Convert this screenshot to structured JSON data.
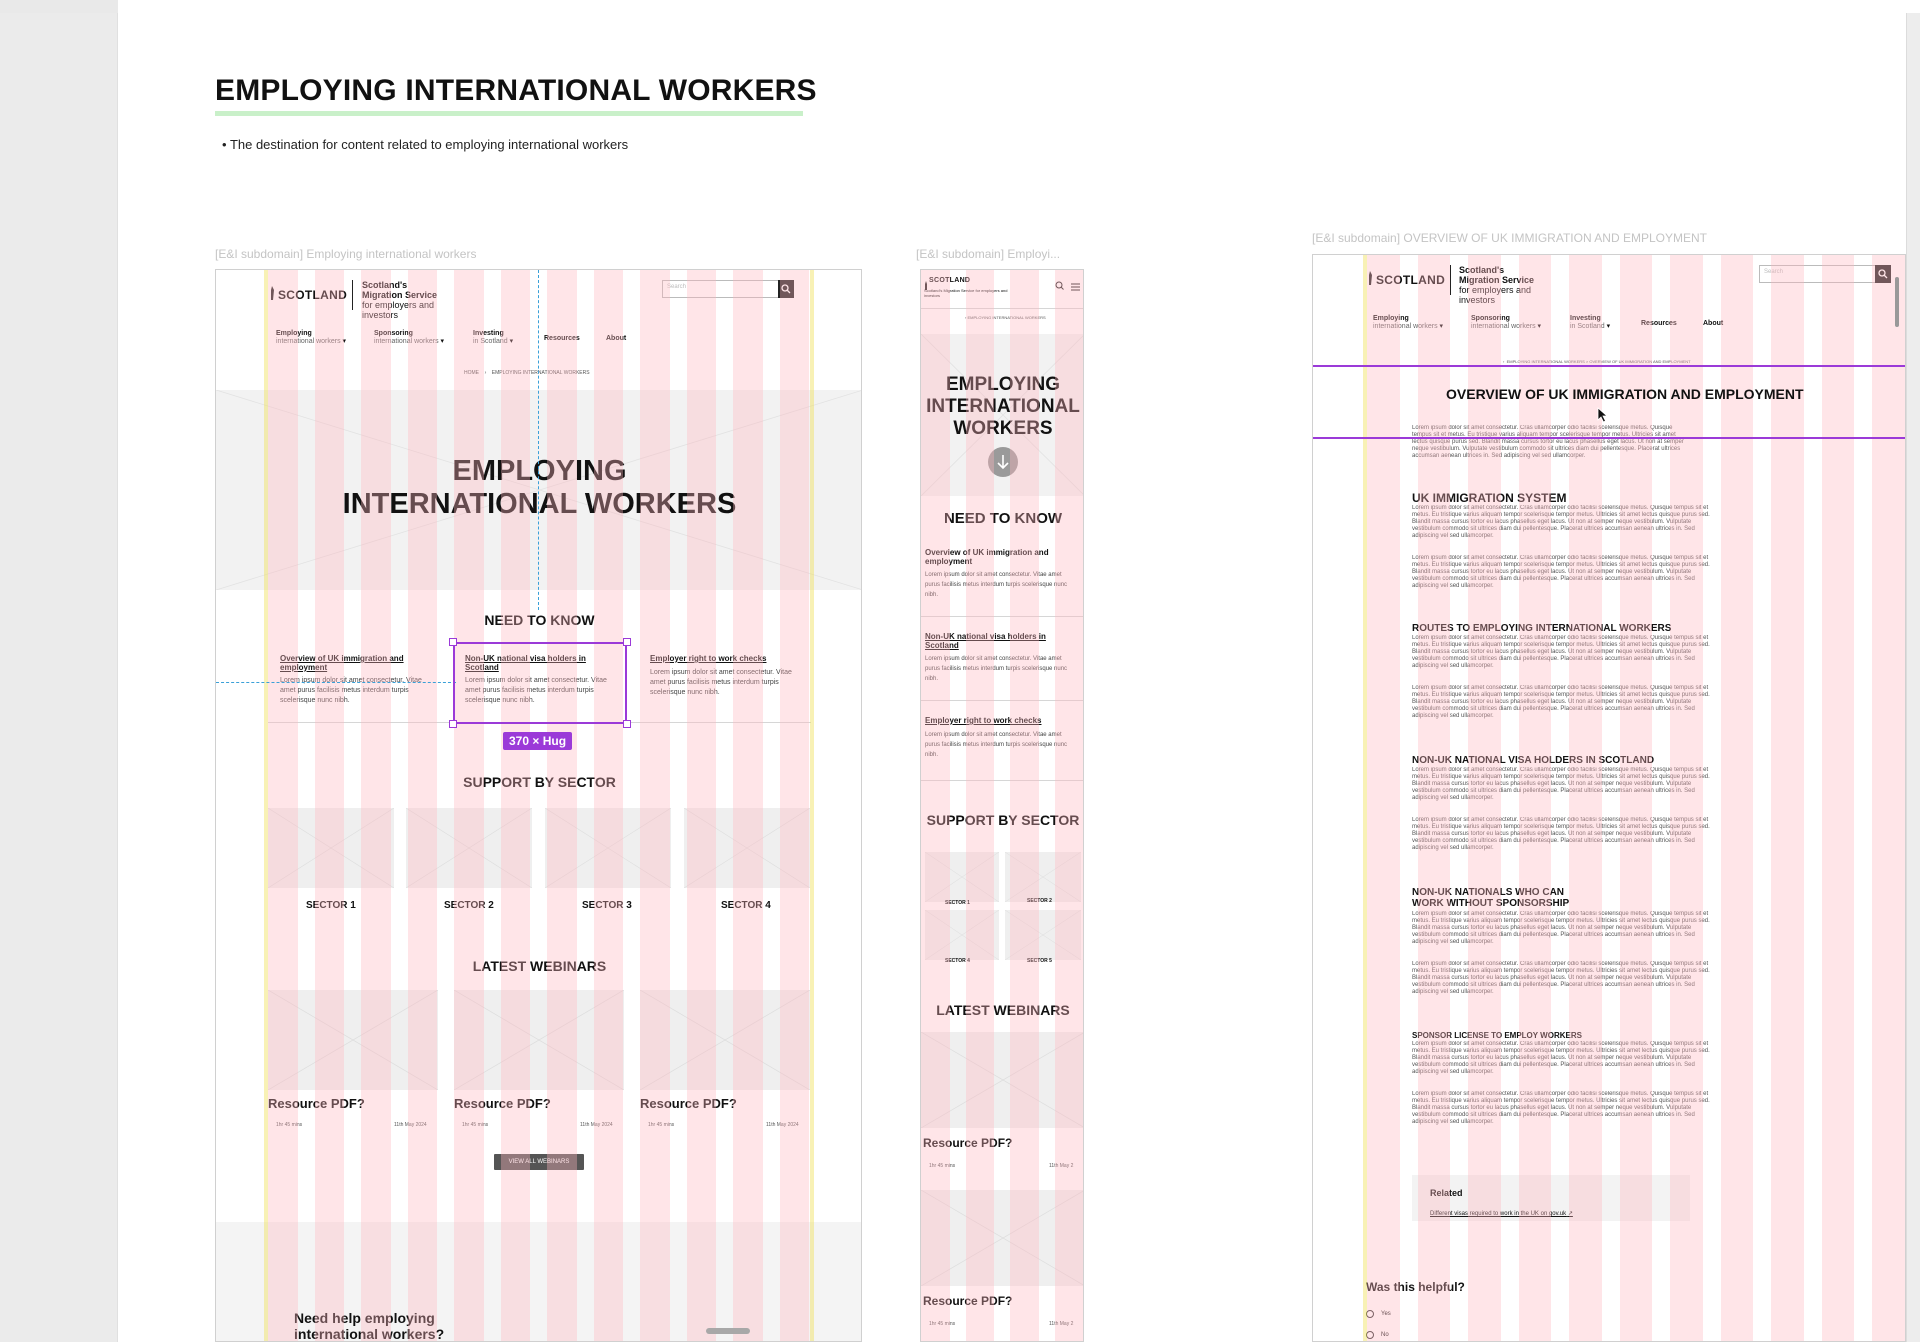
{
  "page": {
    "title": "EMPLOYING INTERNATIONAL WORKERS",
    "description": "The destination for content related to employing international workers"
  },
  "desktop": {
    "frame_label": "[E&I subdomain] Employing international workers",
    "logo": "SCOTLAND",
    "brand_line1": "Scotland's",
    "brand_line2": "Migration Service",
    "brand_line3": "for employers and",
    "brand_line4": "investors",
    "search_placeholder": "Search",
    "nav": [
      {
        "label": "Employing",
        "sub": "international workers"
      },
      {
        "label": "Sponsoring",
        "sub": "international workers"
      },
      {
        "label": "Investing",
        "sub": "in Scotland"
      },
      {
        "label": "Resources",
        "sub": ""
      },
      {
        "label": "About",
        "sub": ""
      }
    ],
    "breadcrumb_home": "HOME",
    "breadcrumb_current": "EMPLOYING INTERNATIONAL WORKERS",
    "hero_line1": "EMPLOYING",
    "hero_line2": "INTERNATIONAL WORKERS",
    "need_to_know": "NEED TO KNOW",
    "cards": [
      {
        "title": "Overview of UK immigration and employment",
        "body": "Lorem ipsum dolor sit amet consectetur. Vitae amet purus facilisis metus interdum turpis scelerisque nunc nibh."
      },
      {
        "title": "Non-UK national visa holders in Scotland",
        "body": "Lorem ipsum dolor sit amet consectetur. Vitae amet purus facilisis metus interdum turpis scelerisque nunc nibh."
      },
      {
        "title": "Employer right to work checks",
        "body": "Lorem ipsum dolor sit amet consectetur. Vitae amet purus facilisis metus interdum turpis scelerisque nunc nibh."
      }
    ],
    "hug_badge": "370 × Hug",
    "support_by_sector": "SUPPORT BY SECTOR",
    "sectors": [
      "SECTOR 1",
      "SECTOR 2",
      "SECTOR 3",
      "SECTOR 4"
    ],
    "latest_webinars": "LATEST WEBINARS",
    "resources": [
      {
        "title": "Resource PDF?",
        "duration": "1hr 45 mins",
        "date": "11th May 2024"
      },
      {
        "title": "Resource PDF?",
        "duration": "1hr 45 mins",
        "date": "11th May 2024"
      },
      {
        "title": "Resource PDF?",
        "duration": "1hr 45 mins",
        "date": "11th May 2024"
      }
    ],
    "view_all": "VIEW ALL WEBINARS",
    "need_help_line1": "Need help employing",
    "need_help_line2": "international workers?"
  },
  "mobile": {
    "frame_label": "[E&I subdomain] Employi...",
    "logo": "SCOTLAND",
    "brand": "Scotland's Migration Service for employers and investors",
    "breadcrumb": "EMPLOYING INTERNATIONAL WORKERS",
    "hero_line1": "EMPLOYING",
    "hero_line2": "INTERNATIONAL",
    "hero_line3": "WORKERS",
    "need_to_know": "NEED TO KNOW",
    "cards": [
      {
        "title": "Overview of UK immigration and employment",
        "body": "Lorem ipsum dolor sit amet consectetur. Vitae amet purus facilisis metus interdum turpis scelerisque nunc nibh."
      },
      {
        "title": "Non-UK national visa holders in Scotland",
        "body": "Lorem ipsum dolor sit amet consectetur. Vitae amet purus facilisis metus interdum turpis scelerisque nunc nibh."
      },
      {
        "title": "Employer right to work checks",
        "body": "Lorem ipsum dolor sit amet consectetur. Vitae amet purus facilisis metus interdum turpis scelerisque nunc nibh."
      }
    ],
    "support_by_sector": "SUPPORT BY SECTOR",
    "sectors": [
      "SECTOR 1",
      "SECTOR 2",
      "SECTOR 4",
      "SECTOR 5"
    ],
    "latest_webinars": "LATEST WEBINARS",
    "resource_title": "Resource PDF?",
    "resource_duration": "1hr 45 mins",
    "resource_date": "11th May 2",
    "resource2_title": "Resource PDF?",
    "resource2_duration": "1hr 45 mins",
    "resource2_date": "11th May 2"
  },
  "article": {
    "frame_label": "[E&I subdomain] OVERVIEW OF UK IMMIGRATION AND EMPLOYMENT",
    "logo": "SCOTLAND",
    "brand_line1": "Scotland's",
    "brand_line2": "Migration Service",
    "brand_line3": "for employers and",
    "brand_line4": "investors",
    "search_placeholder": "Search",
    "nav": [
      {
        "label": "Employing",
        "sub": "international workers"
      },
      {
        "label": "Sponsoring",
        "sub": "international workers"
      },
      {
        "label": "Investing",
        "sub": "in Scotland"
      },
      {
        "label": "Resources",
        "sub": ""
      },
      {
        "label": "About",
        "sub": ""
      }
    ],
    "breadcrumb": "EMPLOYING INTERNATIONAL WORKERS   >   OVERVIEW OF UK IMMIGRATION AND EMPLOYMENT",
    "title": "OVERVIEW OF UK IMMIGRATION AND EMPLOYMENT",
    "intro": "Lorem ipsum dolor sit amet consectetur. Cras ullamcorper odio facilisi scelerisque metus. Quisque tempus sit et metus. Eu tristique varius aliquam tempor scelerisque tempor metus. Ultricies sit amet lectus quisque purus sed. Blandit massa cursus tortor eu lacus phasellus eget lacus. Ut non at semper neque vestibulum. Vulputate vestibulum commodo sit ultrices diam dui pellentesque. Placerat ultrices accumsan aenean ultrices in. Sed adipiscing vel sed ullamcorper.",
    "sections": [
      "UK IMMIGRATION SYSTEM",
      "ROUTES TO EMPLOYING INTERNATIONAL WORKERS",
      "NON-UK NATIONAL VISA HOLDERS IN SCOTLAND",
      "NON-UK NATIONALS WHO CAN WORK WITHOUT SPONSORSHIP",
      "SPONSOR LICENSE TO EMPLOY WORKERS"
    ],
    "para": "Lorem ipsum dolor sit amet consectetur. Cras ullamcorper odio facilisi scelerisque metus. Quisque tempus sit et metus. Eu tristique varius aliquam tempor scelerisque tempor metus. Ultricies sit amet lectus quisque purus sed. Blandit massa cursus tortor eu lacus phasellus eget lacus. Ut non at semper neque vestibulum. Vulputate vestibulum commodo sit ultrices diam dui pellentesque. Placerat ultrices accumsan aenean ultrices in. Sed adipiscing vel sed ullamcorper.",
    "related_label": "Related",
    "related_link": "Different visas required to work in the UK on gov.uk",
    "helpful": "Was this helpful?",
    "yes": "Yes",
    "no": "No"
  }
}
